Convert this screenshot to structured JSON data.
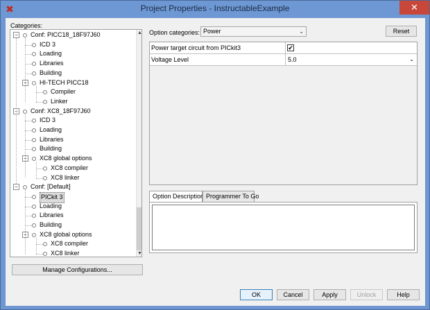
{
  "window": {
    "title": "Project Properties - InstructableExample",
    "close_glyph": "✕",
    "app_icon_glyph": "✖"
  },
  "categories": {
    "label": "Categories:",
    "tree": [
      {
        "label": "Conf: PICC18_18F97J60",
        "level": 0,
        "expander": "−"
      },
      {
        "label": "ICD 3",
        "level": 1
      },
      {
        "label": "Loading",
        "level": 1
      },
      {
        "label": "Libraries",
        "level": 1
      },
      {
        "label": "Building",
        "level": 1
      },
      {
        "label": "HI-TECH PICC18",
        "level": 1,
        "expander": "−"
      },
      {
        "label": "Compiler",
        "level": 2
      },
      {
        "label": "Linker",
        "level": 2
      },
      {
        "label": "Conf: XC8_18F97J60",
        "level": 0,
        "expander": "−"
      },
      {
        "label": "ICD 3",
        "level": 1
      },
      {
        "label": "Loading",
        "level": 1
      },
      {
        "label": "Libraries",
        "level": 1
      },
      {
        "label": "Building",
        "level": 1
      },
      {
        "label": "XC8 global options",
        "level": 1,
        "expander": "−"
      },
      {
        "label": "XC8 compiler",
        "level": 2
      },
      {
        "label": "XC8 linker",
        "level": 2
      },
      {
        "label": "Conf: [Default]",
        "level": 0,
        "expander": "−"
      },
      {
        "label": "PICkit 3",
        "level": 1,
        "selected": true
      },
      {
        "label": "Loading",
        "level": 1
      },
      {
        "label": "Libraries",
        "level": 1
      },
      {
        "label": "Building",
        "level": 1
      },
      {
        "label": "XC8 global options",
        "level": 1,
        "expander": "−"
      },
      {
        "label": "XC8 compiler",
        "level": 2
      },
      {
        "label": "XC8 linker",
        "level": 2
      }
    ],
    "scroll_up_glyph": "▲",
    "scroll_down_glyph": "▼"
  },
  "manage_configurations": "Manage Configurations...",
  "options": {
    "label": "Option categories:",
    "selected": "Power",
    "chevron": "⌄",
    "reset": "Reset",
    "rows": {
      "power_target": {
        "label": "Power target circuit from PICkit3",
        "checked_glyph": "✔"
      },
      "voltage": {
        "label": "Voltage Level",
        "value": "5.0",
        "chevron": "⌄"
      }
    }
  },
  "tabs": {
    "description": "Option Description",
    "programmer": "Programmer To Go"
  },
  "buttons": {
    "ok": "OK",
    "cancel": "Cancel",
    "apply": "Apply",
    "unlock": "Unlock",
    "help": "Help"
  }
}
